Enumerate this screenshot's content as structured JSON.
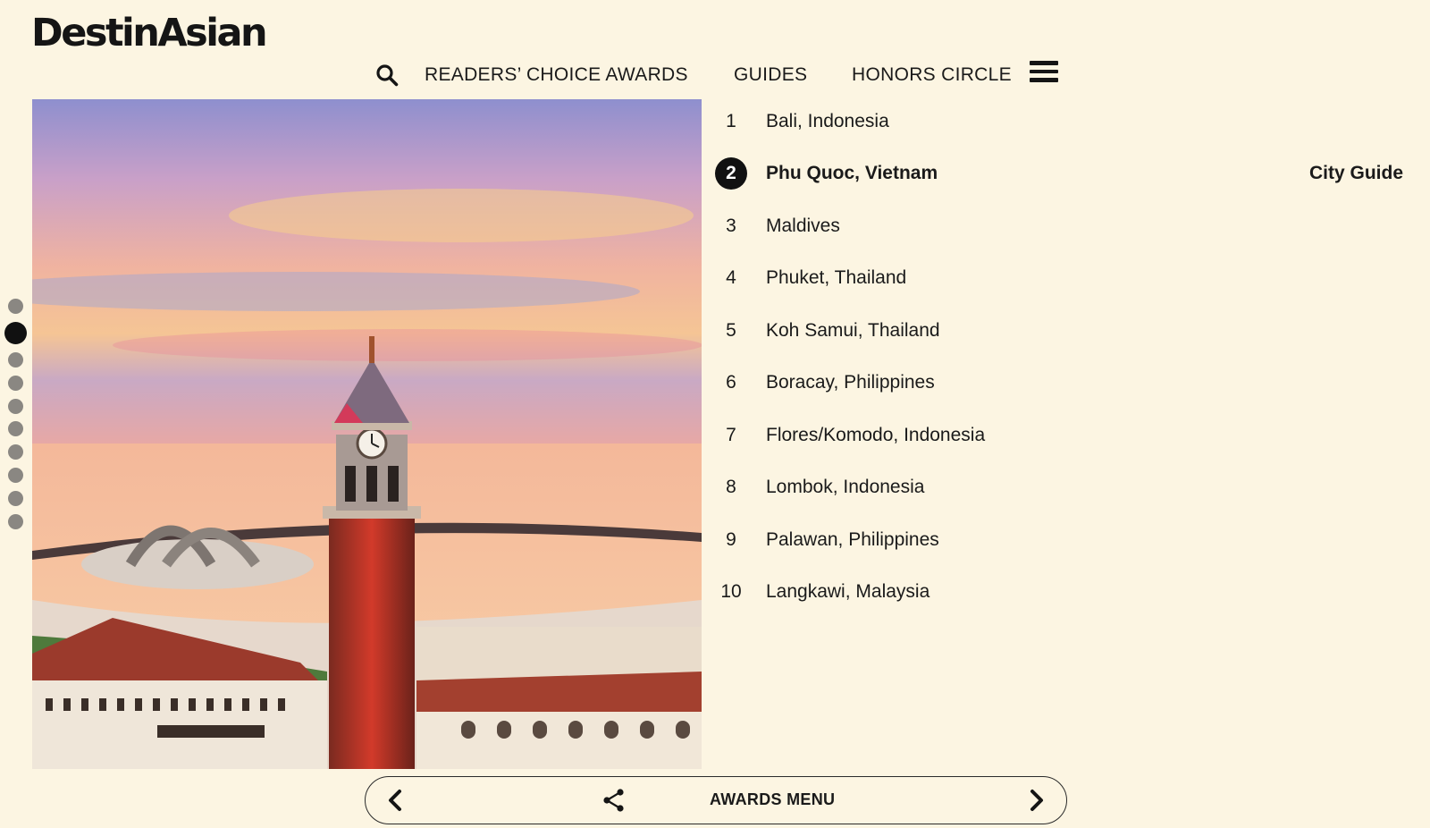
{
  "brand": {
    "logo_text": "DestinAsian"
  },
  "nav": {
    "items": [
      {
        "label": "READERS’ CHOICE AWARDS"
      },
      {
        "label": "GUIDES"
      },
      {
        "label": "HONORS CIRCLE"
      }
    ],
    "icons": [
      "search-icon",
      "hamburger-menu-icon"
    ]
  },
  "slideshow": {
    "total_slides": 10,
    "active_index": 2
  },
  "rankings": {
    "items": [
      {
        "rank": "1",
        "name": "Bali, Indonesia"
      },
      {
        "rank": "2",
        "name": "Phu Quoc, Vietnam",
        "active": true,
        "link": "City Guide"
      },
      {
        "rank": "3",
        "name": "Maldives"
      },
      {
        "rank": "4",
        "name": "Phuket, Thailand"
      },
      {
        "rank": "5",
        "name": "Koh Samui, Thailand"
      },
      {
        "rank": "6",
        "name": "Boracay, Philippines"
      },
      {
        "rank": "7",
        "name": "Flores/Komodo, Indonesia"
      },
      {
        "rank": "8",
        "name": "Lombok, Indonesia"
      },
      {
        "rank": "9",
        "name": "Palawan, Philippines"
      },
      {
        "rank": "10",
        "name": "Langkawi, Malaysia"
      }
    ]
  },
  "bottom_bar": {
    "label": "AWARDS MENU",
    "icons": [
      "chevron-left-icon",
      "share-icon",
      "chevron-right-icon"
    ]
  },
  "colors": {
    "background": "#fcf5e2",
    "text": "#1a1a1a",
    "active": "#111111",
    "inactive_dot": "#8a8782"
  }
}
